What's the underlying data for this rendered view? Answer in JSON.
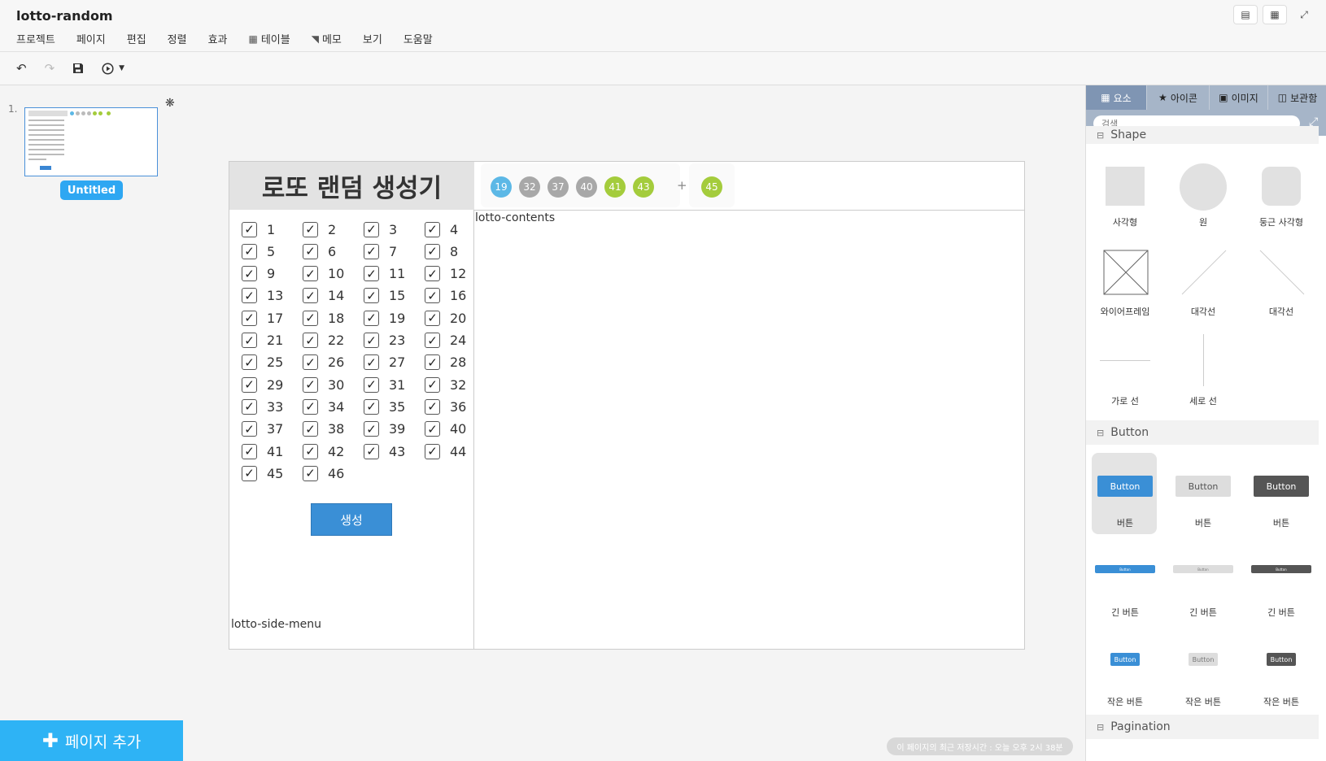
{
  "app": {
    "title": "lotto-random"
  },
  "menu": [
    {
      "label": "프로젝트",
      "icon": ""
    },
    {
      "label": "페이지",
      "icon": ""
    },
    {
      "label": "편집",
      "icon": ""
    },
    {
      "label": "정렬",
      "icon": ""
    },
    {
      "label": "효과",
      "icon": ""
    },
    {
      "label": "테이블",
      "icon": "table-icon"
    },
    {
      "label": "메모",
      "icon": "memo-icon"
    },
    {
      "label": "보기",
      "icon": ""
    },
    {
      "label": "도움말",
      "icon": ""
    }
  ],
  "pages": {
    "number": "1.",
    "name": "Untitled",
    "add_label": "페이지 추가"
  },
  "canvas": {
    "title": "로또 랜덤 생성기",
    "numbers": [
      "1",
      "2",
      "3",
      "4",
      "5",
      "6",
      "7",
      "8",
      "9",
      "10",
      "11",
      "12",
      "13",
      "14",
      "15",
      "16",
      "17",
      "18",
      "19",
      "20",
      "21",
      "22",
      "23",
      "24",
      "25",
      "26",
      "27",
      "28",
      "29",
      "30",
      "31",
      "32",
      "33",
      "34",
      "35",
      "36",
      "37",
      "38",
      "39",
      "40",
      "41",
      "42",
      "43",
      "44",
      "45",
      "46"
    ],
    "generate_label": "생성",
    "side_menu_label": "lotto-side-menu",
    "contents_label": "lotto-contents",
    "balls": [
      {
        "value": "19",
        "color": "#5cb8e6"
      },
      {
        "value": "32",
        "color": "#a8a8a8"
      },
      {
        "value": "37",
        "color": "#a8a8a8"
      },
      {
        "value": "40",
        "color": "#a8a8a8"
      },
      {
        "value": "41",
        "color": "#a4cc3c"
      },
      {
        "value": "43",
        "color": "#a4cc3c"
      }
    ],
    "plus": "+",
    "bonus": {
      "value": "45",
      "color": "#a4cc3c"
    }
  },
  "status": {
    "save_text": "이 페이지의 최근 저장시간 : 오늘 오후 2시 38분"
  },
  "panel": {
    "tabs": [
      {
        "label": "요소",
        "icon": "grid-icon",
        "active": true
      },
      {
        "label": "아이콘",
        "icon": "star-icon",
        "active": false
      },
      {
        "label": "이미지",
        "icon": "image-icon",
        "active": false
      },
      {
        "label": "보관함",
        "icon": "archive-icon",
        "active": false
      }
    ],
    "search_placeholder": "검색",
    "shape_section": "Shape",
    "shapes": [
      "사각형",
      "원",
      "둥근 사각형",
      "와이어프레임",
      "대각선",
      "대각선",
      "가로 선",
      "세로 선"
    ],
    "button_section": "Button",
    "button_demo_text": "Button",
    "buttons": [
      "버튼",
      "버튼",
      "버튼",
      "긴 버튼",
      "긴 버튼",
      "긴 버튼",
      "작은 버튼",
      "작은 버튼",
      "작은 버튼"
    ],
    "pagination_section": "Pagination"
  }
}
